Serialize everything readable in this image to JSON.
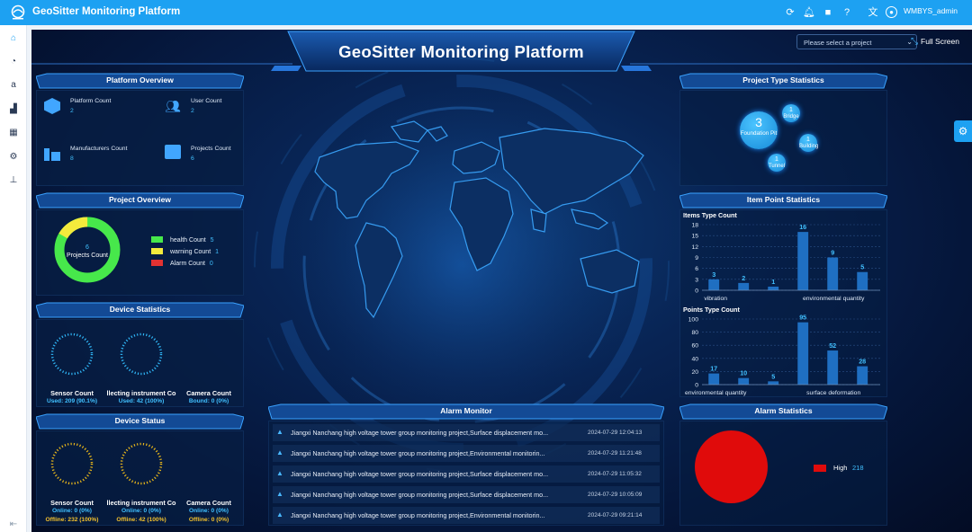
{
  "app": {
    "title": "GeoSitter Monitoring Platform",
    "user": "WMBYS_admin"
  },
  "toolbar_icons": [
    "refresh-icon",
    "bell-icon",
    "camera-icon",
    "help-icon",
    "translate-icon",
    "user-icon"
  ],
  "sidebar": {
    "items": [
      "home-icon",
      "dashboard-icon",
      "amazon-icon",
      "building-icon",
      "grid-icon",
      "settings-icon",
      "org-chart-icon"
    ]
  },
  "dashboard": {
    "title": "GeoSitter Monitoring Platform",
    "project_select_placeholder": "Please select a project",
    "full_screen_label": "Full Screen"
  },
  "platform_overview": {
    "title": "Platform Overview",
    "stats": [
      {
        "label": "Platform Count",
        "value": "2",
        "icon": "cube-icon"
      },
      {
        "label": "User Count",
        "value": "2",
        "icon": "users-icon"
      },
      {
        "label": "Manufacturers Count",
        "value": "8",
        "icon": "factory-icon"
      },
      {
        "label": "Projects Count",
        "value": "6",
        "icon": "folder-icon"
      }
    ]
  },
  "project_overview": {
    "title": "Project Overview",
    "center_value": "6",
    "center_label": "Projects Count",
    "legend": [
      {
        "label": "health Count",
        "value": "5",
        "color": "#47e84b"
      },
      {
        "label": "warning Count",
        "value": "1",
        "color": "#f4ea3c"
      },
      {
        "label": "Alarm Count",
        "value": "0",
        "color": "#e23232"
      }
    ]
  },
  "device_statistics": {
    "title": "Device Statistics",
    "items": [
      {
        "label": "Sensor Count",
        "sub": "Used: 209 (90.1%)"
      },
      {
        "label": "llecting instrument Co",
        "sub": "Used: 42 (100%)"
      },
      {
        "label": "Camera Count",
        "sub": "Bound: 0 (0%)"
      }
    ]
  },
  "device_status": {
    "title": "Device Status",
    "items": [
      {
        "label": "Sensor Count",
        "online": "Online: 0 (0%)",
        "offline": "Offline: 232 (100%)"
      },
      {
        "label": "llecting instrument Co",
        "online": "Online: 0 (0%)",
        "offline": "Offline: 42 (100%)"
      },
      {
        "label": "Camera Count",
        "online": "Online: 0 (0%)",
        "offline": "Offline: 0 (0%)"
      }
    ]
  },
  "project_type_statistics": {
    "title": "Project Type Statistics",
    "bubbles": [
      {
        "value": "3",
        "label": "Foundation Pit"
      },
      {
        "value": "1",
        "label": "Bridge"
      },
      {
        "value": "1",
        "label": "Building"
      },
      {
        "value": "1",
        "label": "Tunnel"
      }
    ]
  },
  "item_point_statistics": {
    "title": "Item Point Statistics"
  },
  "chart_data": [
    {
      "type": "bar",
      "title": "Items Type Count",
      "categories": [
        "vibration",
        "",
        "",
        "environmental quantity",
        "",
        ""
      ],
      "values": [
        3,
        2,
        1,
        16,
        9,
        5
      ],
      "ylim": [
        0,
        18
      ],
      "yticks": [
        "18",
        "15",
        "12",
        "9",
        "6",
        "3",
        "0"
      ],
      "grid": true
    },
    {
      "type": "bar",
      "title": "Points Type Count",
      "categories": [
        "environmental quantity",
        "",
        "",
        "surface deformation",
        "",
        ""
      ],
      "values": [
        17,
        10,
        5,
        95,
        52,
        28
      ],
      "ylim": [
        0,
        100
      ],
      "yticks": [
        "100",
        "80",
        "60",
        "40",
        "20",
        "0"
      ],
      "grid": true
    },
    {
      "type": "pie",
      "title": "Alarm Statistics",
      "slices": [
        {
          "label": "High",
          "value": 218,
          "color": "#e00b0b"
        }
      ]
    }
  ],
  "alarm_monitor": {
    "title": "Alarm Monitor",
    "rows": [
      {
        "text": "Jiangxi Nanchang high voltage tower group monitoring project,Surface displacement mo...",
        "time": "2024-07-29 12:04:13"
      },
      {
        "text": "Jiangxi Nanchang high voltage tower group monitoring project,Environmental monitorin...",
        "time": "2024-07-29 11:21:48"
      },
      {
        "text": "Jiangxi Nanchang high voltage tower group monitoring project,Surface displacement mo...",
        "time": "2024-07-29 11:05:32"
      },
      {
        "text": "Jiangxi Nanchang high voltage tower group monitoring project,Surface displacement mo...",
        "time": "2024-07-29 10:05:09"
      },
      {
        "text": "Jiangxi Nanchang high voltage tower group monitoring project,Environmental monitorin...",
        "time": "2024-07-29 09:21:14"
      }
    ]
  },
  "alarm_statistics": {
    "title": "Alarm Statistics",
    "legend_label": "High",
    "legend_value": "218"
  }
}
